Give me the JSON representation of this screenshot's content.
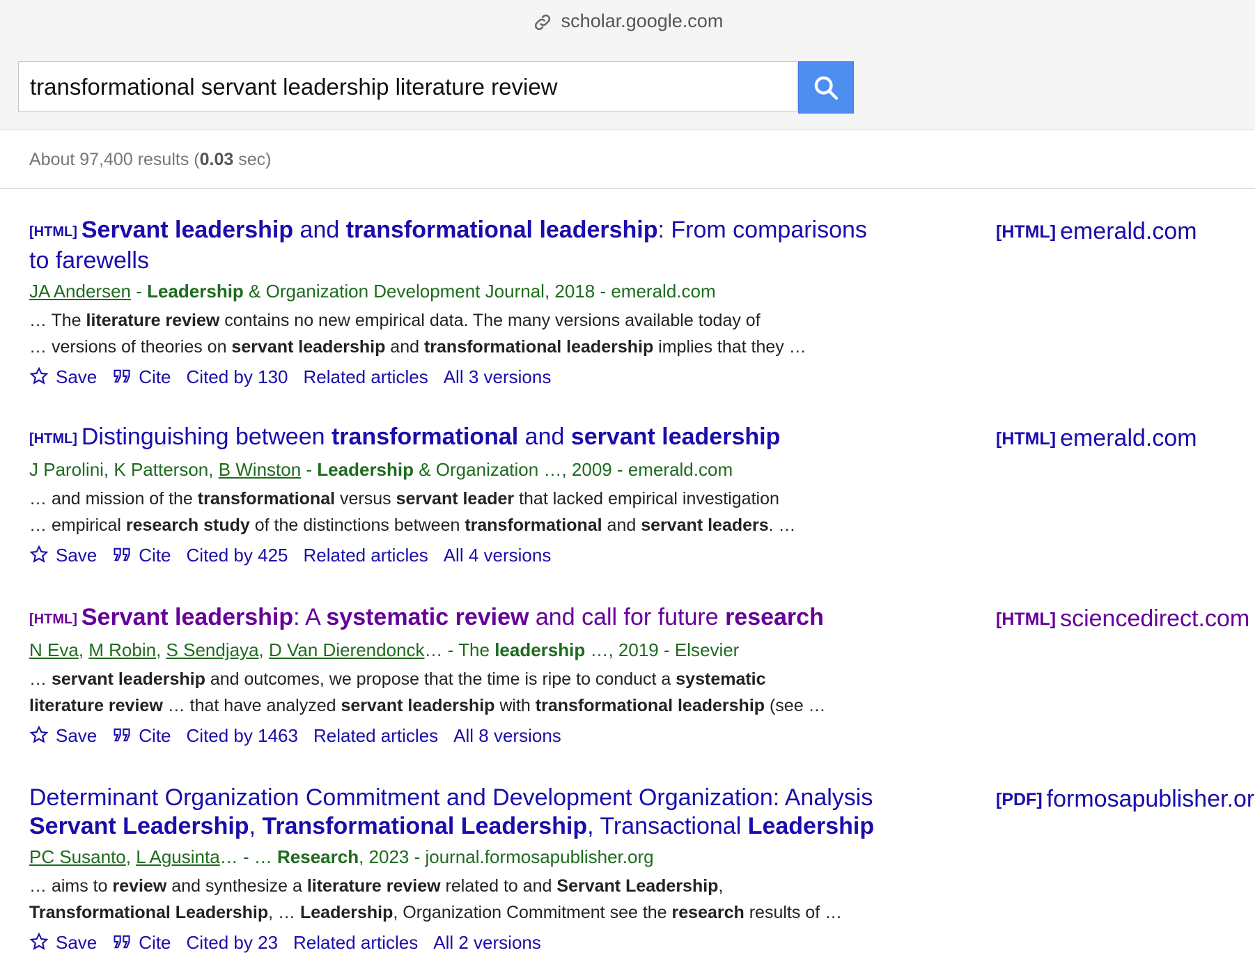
{
  "browser": {
    "url": "scholar.google.com"
  },
  "search": {
    "query": "transformational servant leadership literature review"
  },
  "stats": {
    "prefix": "About 97,400 results (",
    "time": "0.03",
    "suffix": " sec)"
  },
  "actions": {
    "save": "Save",
    "cite": "Cite",
    "related": "Related articles"
  },
  "results": [
    {
      "tag": "[HTML]",
      "title_parts": [
        "Servant leadership",
        " and ",
        "transformational leadership",
        ": From comparisons to farewells"
      ],
      "authors": [
        "JA Andersen"
      ],
      "meta_parts": [
        " - ",
        "Leadership",
        " & Organization Development Journal, 2018 - emerald.com"
      ],
      "snippet_1": [
        "… The ",
        "literature review",
        " contains no new empirical data. The many versions available today of"
      ],
      "snippet_2": [
        "… versions of theories on ",
        "servant leadership",
        " and ",
        "transformational leadership",
        " implies that they …"
      ],
      "cited_by": "Cited by 130",
      "versions": "All 3 versions",
      "side_tag": "[HTML]",
      "side_domain": "emerald.com"
    },
    {
      "tag": "[HTML]",
      "title_parts": [
        "Distinguishing between ",
        "transformational",
        " and ",
        "servant leadership"
      ],
      "authors": [
        "J Parolini, K Patterson, ",
        "B Winston"
      ],
      "meta_parts": [
        " - ",
        "Leadership",
        " & Organization …, 2009 - emerald.com"
      ],
      "snippet_1": [
        "… and mission of the ",
        "transformational",
        " versus ",
        "servant leader",
        " that lacked empirical investigation"
      ],
      "snippet_2": [
        "… empirical ",
        "research study",
        " of the distinctions between ",
        "transformational",
        " and ",
        "servant leaders",
        ". …"
      ],
      "cited_by": "Cited by 425",
      "versions": "All 4 versions",
      "side_tag": "[HTML]",
      "side_domain": "emerald.com"
    },
    {
      "tag": "[HTML]",
      "title_parts": [
        "Servant leadership",
        ": A ",
        "systematic review",
        " and call for future ",
        "research"
      ],
      "authors": [
        "N Eva",
        "M Robin",
        "S Sendjaya",
        "D Van Dierendonck"
      ],
      "meta_parts": [
        "… - The ",
        "leadership",
        " …, 2019 - Elsevier"
      ],
      "snippet_1": [
        "… ",
        "servant leadership",
        " and outcomes, we propose that the time is ripe to conduct a ",
        "systematic"
      ],
      "snippet_2": [
        "literature review",
        " … that have analyzed ",
        "servant leadership",
        " with ",
        "transformational leadership",
        " (see …"
      ],
      "cited_by": "Cited by 1463",
      "versions": "All 8 versions",
      "side_tag": "[HTML]",
      "side_domain": "sciencedirect.com"
    },
    {
      "title_line1": "Determinant Organization Commitment and Development Organization: Analysis",
      "title_parts": [
        "Servant Leadership",
        ", ",
        "Transformational Leadership",
        ", Transactional ",
        "Leadership"
      ],
      "authors": [
        "PC Susanto",
        "L Agusinta"
      ],
      "meta_parts": [
        "… - … ",
        "Research",
        ", 2023 - journal.formosapublisher.org"
      ],
      "snippet_1": [
        "… aims to ",
        "review",
        " and synthesize a ",
        "literature review",
        " related to and ",
        "Servant Leadership",
        ","
      ],
      "snippet_2": [
        "Transformational Leadership",
        ", … ",
        "Leadership",
        ", Organization Commitment see the ",
        "research",
        " results of …"
      ],
      "cited_by": "Cited by 23",
      "versions": "All 2 versions",
      "side_tag": "[PDF]",
      "side_domain": "formosapublisher.org"
    }
  ]
}
